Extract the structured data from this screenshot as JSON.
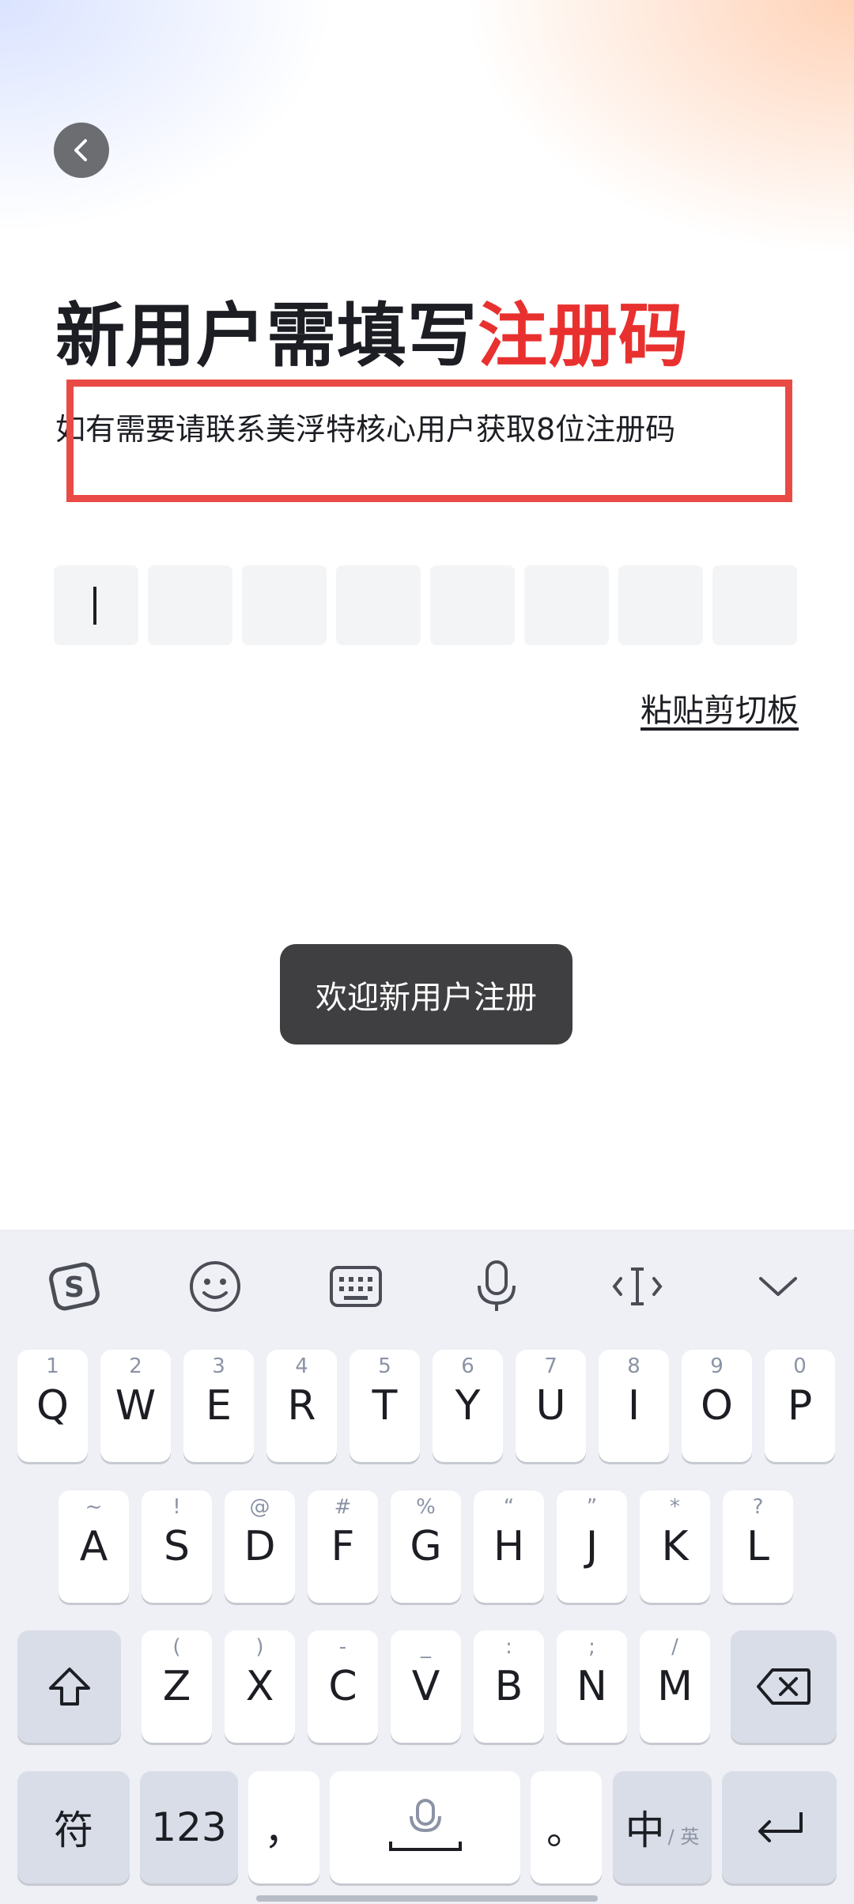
{
  "header": {
    "back_icon": "chevron-left-icon"
  },
  "title": {
    "main": "新用户需填写",
    "accent": "注册码",
    "accent_color": "#e8312f"
  },
  "subtitle": "如有需要请联系美浮特核心用户获取8位注册码",
  "code_input": {
    "length": 8,
    "values": [
      "",
      "",
      "",
      "",
      "",
      "",
      "",
      ""
    ]
  },
  "paste_label": "粘贴剪切板",
  "toast": "欢迎新用户注册",
  "keyboard": {
    "toolbar": [
      "sogou-logo-icon",
      "emoji-icon",
      "keyboard-icon",
      "microphone-icon",
      "cursor-icon",
      "chevron-down-icon"
    ],
    "row1": [
      {
        "main": "Q",
        "sub": "1"
      },
      {
        "main": "W",
        "sub": "2"
      },
      {
        "main": "E",
        "sub": "3"
      },
      {
        "main": "R",
        "sub": "4"
      },
      {
        "main": "T",
        "sub": "5"
      },
      {
        "main": "Y",
        "sub": "6"
      },
      {
        "main": "U",
        "sub": "7"
      },
      {
        "main": "I",
        "sub": "8"
      },
      {
        "main": "O",
        "sub": "9"
      },
      {
        "main": "P",
        "sub": "0"
      }
    ],
    "row2": [
      {
        "main": "A",
        "sub": "~"
      },
      {
        "main": "S",
        "sub": "!"
      },
      {
        "main": "D",
        "sub": "@"
      },
      {
        "main": "F",
        "sub": "#"
      },
      {
        "main": "G",
        "sub": "%"
      },
      {
        "main": "H",
        "sub": "“"
      },
      {
        "main": "J",
        "sub": "”"
      },
      {
        "main": "K",
        "sub": "*"
      },
      {
        "main": "L",
        "sub": "?"
      }
    ],
    "row3": [
      {
        "main": "Z",
        "sub": "("
      },
      {
        "main": "X",
        "sub": ")"
      },
      {
        "main": "C",
        "sub": "-"
      },
      {
        "main": "V",
        "sub": "_"
      },
      {
        "main": "B",
        "sub": ":"
      },
      {
        "main": "N",
        "sub": ";"
      },
      {
        "main": "M",
        "sub": "/"
      }
    ],
    "symbols_label": "符",
    "numbers_label": "123",
    "comma_label": "，",
    "period_label": "。",
    "lang_label": "中",
    "lang_alt_label": "/ 英"
  }
}
